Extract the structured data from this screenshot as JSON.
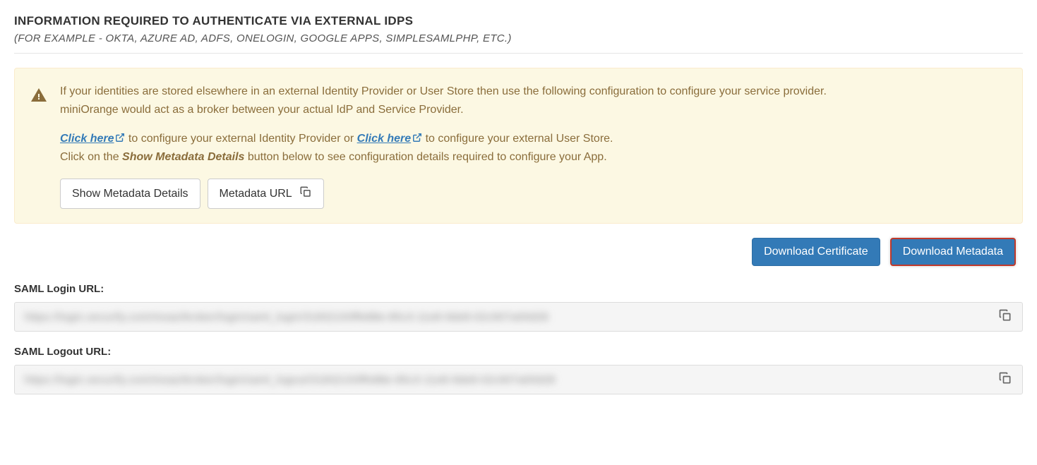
{
  "header": {
    "title": "INFORMATION REQUIRED TO AUTHENTICATE VIA EXTERNAL IDPS",
    "subtitle": "(FOR EXAMPLE - OKTA, AZURE AD, ADFS, ONELOGIN, GOOGLE APPS, SIMPLESAMLPHP, ETC.)"
  },
  "info": {
    "para1a": "If your identities are stored elsewhere in an external Identity Provider or User Store then use the following configuration to configure your service provider.",
    "para1b": "miniOrange would act as a broker between your actual IdP and Service Provider.",
    "link1": "Click here",
    "text2a": " to configure your external Identity Provider or ",
    "link2": "Click here",
    "text2b": " to configure your external User Store.",
    "text3a": "Click on the ",
    "text3b": "Show Metadata Details",
    "text3c": " button below to see configuration details required to configure your App."
  },
  "buttons": {
    "show_metadata": "Show Metadata Details",
    "metadata_url": "Metadata URL",
    "download_cert": "Download Certificate",
    "download_metadata": "Download Metadata"
  },
  "fields": {
    "login_label": "SAML Login URL:",
    "login_value": "https://login.xecurify.com/moas/broker/login/saml_login/31832193ffe88e-85c3-11e8-9de8-02c907a00d28",
    "logout_label": "SAML Logout URL:",
    "logout_value": "https://login.xecurify.com/moas/broker/login/saml_logout/31832193ffe88e-85c3-11e8-9de8-02c907a00d28"
  }
}
